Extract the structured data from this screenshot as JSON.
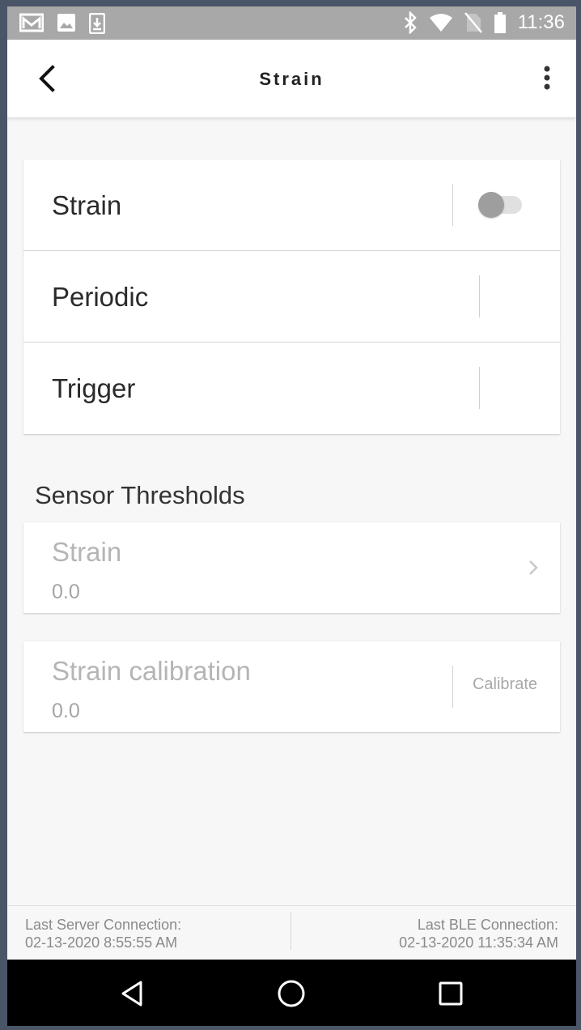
{
  "status_bar": {
    "time": "11:36",
    "left_icons": [
      "gmail-icon",
      "image-icon",
      "download-icon"
    ],
    "right_icons": [
      "bluetooth-icon",
      "wifi-icon",
      "no-sim-icon",
      "battery-icon"
    ]
  },
  "app_bar": {
    "title": "Strain",
    "back_icon": "back-arrow-icon",
    "menu_icon": "more-vert-icon"
  },
  "settings": {
    "rows": [
      {
        "label": "Strain",
        "control": "switch",
        "checked": false
      },
      {
        "label": "Periodic",
        "control": "none"
      },
      {
        "label": "Trigger",
        "control": "none"
      }
    ]
  },
  "sensor_thresholds": {
    "title": "Sensor Thresholds",
    "strain": {
      "label": "Strain",
      "value": "0.0"
    },
    "calibration": {
      "label": "Strain calibration",
      "value": "0.0",
      "action": "Calibrate"
    }
  },
  "footer": {
    "server_label": "Last Server Connection:",
    "server_value": "02-13-2020 8:55:55 AM",
    "ble_label": "Last BLE Connection:",
    "ble_value": "02-13-2020 11:35:34 AM"
  },
  "nav_bar": {
    "buttons": [
      "back-triangle-icon",
      "home-circle-icon",
      "recents-square-icon"
    ]
  },
  "colors": {
    "status_bar": "#a8a8a8",
    "background": "#f7f7f7",
    "card": "#ffffff",
    "disabled_text": "#b5b5b5",
    "nav_bar": "#000000"
  }
}
